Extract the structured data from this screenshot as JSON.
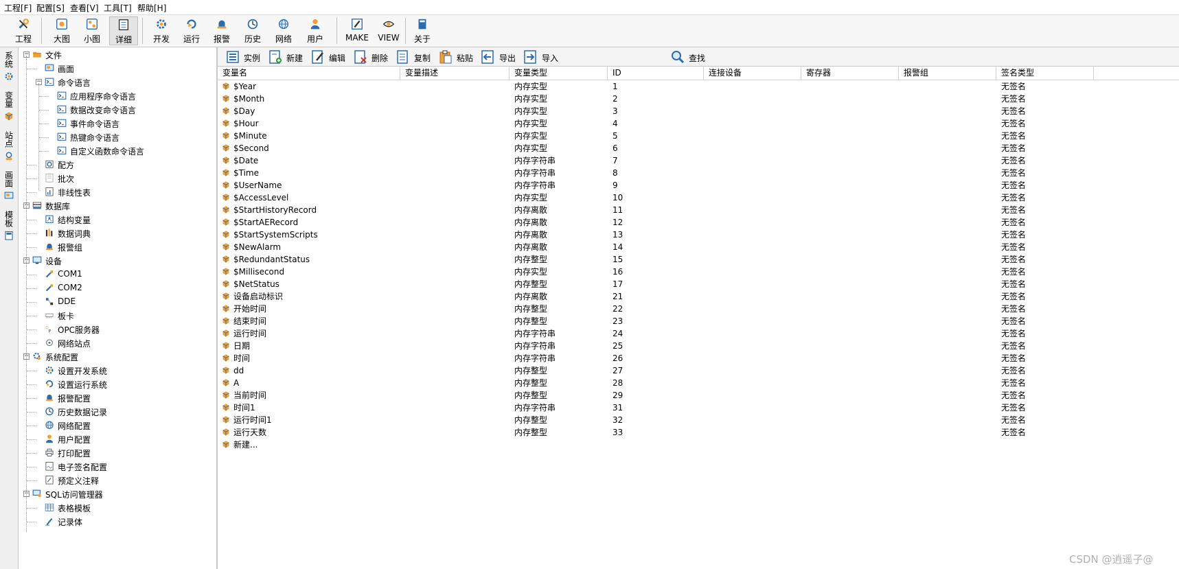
{
  "menu": [
    {
      "name": "menu-project",
      "label": "工程[F]"
    },
    {
      "name": "menu-config",
      "label": "配置[S]"
    },
    {
      "name": "menu-view",
      "label": "查看[V]"
    },
    {
      "name": "menu-tools",
      "label": "工具[T]"
    },
    {
      "name": "menu-help",
      "label": "帮助[H]"
    }
  ],
  "toolbar": [
    {
      "name": "toolbar-project-button",
      "label": "工程",
      "icon": "wrench-icon"
    },
    {
      "name": "toolbar-large-icon-button",
      "label": "大图",
      "icon": "large-icons-icon"
    },
    {
      "name": "toolbar-small-icon-button",
      "label": "小图",
      "icon": "small-icons-icon"
    },
    {
      "name": "toolbar-detail-button",
      "label": "详细",
      "icon": "detail-view-icon",
      "active": true
    },
    {
      "name": "toolbar-develop-button",
      "label": "开发",
      "icon": "develop-gear-icon"
    },
    {
      "name": "toolbar-run-button",
      "label": "运行",
      "icon": "run-icon"
    },
    {
      "name": "toolbar-alarm-button",
      "label": "报警",
      "icon": "alarm-bell-icon"
    },
    {
      "name": "toolbar-history-button",
      "label": "历史",
      "icon": "history-clock-icon"
    },
    {
      "name": "toolbar-network-button",
      "label": "网络",
      "icon": "network-globe-icon"
    },
    {
      "name": "toolbar-user-button",
      "label": "用户",
      "icon": "user-icon"
    },
    {
      "name": "toolbar-make-button",
      "label": "MAKE",
      "icon": "make-pencil-icon"
    },
    {
      "name": "toolbar-view-button",
      "label": "VIEW",
      "icon": "view-eye-icon"
    },
    {
      "name": "toolbar-about-button",
      "label": "关于",
      "icon": "about-book-icon"
    }
  ],
  "vtabs": [
    {
      "name": "vtab-system",
      "label": "系统",
      "icon": "system-gear-icon"
    },
    {
      "name": "vtab-variable",
      "label": "变量",
      "icon": "variable-cube-icon"
    },
    {
      "name": "vtab-station",
      "label": "站点",
      "icon": "station-icon"
    },
    {
      "name": "vtab-screen",
      "label": "画面",
      "icon": "screen-icon"
    },
    {
      "name": "vtab-template",
      "label": "模板",
      "icon": "template-icon"
    }
  ],
  "tree": [
    {
      "level": 0,
      "label": "文件",
      "icon": "folder-icon",
      "expander": "−"
    },
    {
      "level": 1,
      "label": "画面",
      "icon": "screen-icon"
    },
    {
      "level": 1,
      "label": "命令语言",
      "icon": "command-icon",
      "expander": "−"
    },
    {
      "level": 2,
      "label": "应用程序命令语言",
      "icon": "command-icon"
    },
    {
      "level": 2,
      "label": "数据改变命令语言",
      "icon": "command-icon"
    },
    {
      "level": 2,
      "label": "事件命令语言",
      "icon": "command-icon"
    },
    {
      "level": 2,
      "label": "热键命令语言",
      "icon": "command-icon"
    },
    {
      "level": 2,
      "label": "自定义函数命令语言",
      "icon": "command-icon"
    },
    {
      "level": 1,
      "label": "配方",
      "icon": "recipe-icon"
    },
    {
      "level": 1,
      "label": "批次",
      "icon": "batch-icon"
    },
    {
      "level": 1,
      "label": "非线性表",
      "icon": "nonlinear-table-icon"
    },
    {
      "level": 0,
      "label": "数据库",
      "icon": "database-icon",
      "expander": "−"
    },
    {
      "level": 1,
      "label": "结构变量",
      "icon": "struct-variable-icon"
    },
    {
      "level": 1,
      "label": "数据词典",
      "icon": "data-dictionary-icon"
    },
    {
      "level": 1,
      "label": "报警组",
      "icon": "alarm-bell-icon"
    },
    {
      "level": 0,
      "label": "设备",
      "icon": "device-monitor-icon",
      "expander": "−"
    },
    {
      "level": 1,
      "label": "COM1",
      "icon": "com-port-icon"
    },
    {
      "level": 1,
      "label": "COM2",
      "icon": "com-port-icon"
    },
    {
      "level": 1,
      "label": "DDE",
      "icon": "dde-icon"
    },
    {
      "level": 1,
      "label": "板卡",
      "icon": "board-card-icon"
    },
    {
      "level": 1,
      "label": "OPC服务器",
      "icon": "opc-server-icon"
    },
    {
      "level": 1,
      "label": "网络站点",
      "icon": "network-station-icon"
    },
    {
      "level": 0,
      "label": "系统配置",
      "icon": "system-config-icon",
      "expander": "−"
    },
    {
      "level": 1,
      "label": "设置开发系统",
      "icon": "develop-gear-icon"
    },
    {
      "level": 1,
      "label": "设置运行系统",
      "icon": "run-icon"
    },
    {
      "level": 1,
      "label": "报警配置",
      "icon": "alarm-bell-icon"
    },
    {
      "level": 1,
      "label": "历史数据记录",
      "icon": "history-clock-icon"
    },
    {
      "level": 1,
      "label": "网络配置",
      "icon": "network-globe-icon"
    },
    {
      "level": 1,
      "label": "用户配置",
      "icon": "user-icon"
    },
    {
      "level": 1,
      "label": "打印配置",
      "icon": "printer-icon"
    },
    {
      "level": 1,
      "label": "电子签名配置",
      "icon": "e-signature-icon"
    },
    {
      "level": 1,
      "label": "预定义注释",
      "icon": "note-icon"
    },
    {
      "level": 0,
      "label": "SQL访问管理器",
      "icon": "sql-manager-icon",
      "expander": "−"
    },
    {
      "level": 1,
      "label": "表格模板",
      "icon": "table-template-icon"
    },
    {
      "level": 1,
      "label": "记录体",
      "icon": "record-pen-icon"
    }
  ],
  "subtoolbar": [
    {
      "name": "instance-button",
      "label": "实例",
      "icon": "instance-icon"
    },
    {
      "name": "new-button",
      "label": "新建",
      "icon": "new-doc-icon"
    },
    {
      "name": "edit-button",
      "label": "编辑",
      "icon": "edit-doc-icon"
    },
    {
      "name": "delete-button",
      "label": "删除",
      "icon": "delete-doc-icon"
    },
    {
      "name": "copy-button",
      "label": "复制",
      "icon": "copy-doc-icon"
    },
    {
      "name": "paste-button",
      "label": "粘贴",
      "icon": "paste-clipboard-icon"
    },
    {
      "name": "export-button",
      "label": "导出",
      "icon": "export-arrow-icon"
    },
    {
      "name": "import-button",
      "label": "导入",
      "icon": "import-arrow-icon"
    }
  ],
  "search": {
    "placeholder": "",
    "button_label": "查找",
    "icon": "magnifier-icon"
  },
  "table": {
    "columns": [
      "变量名",
      "变量描述",
      "变量类型",
      "ID",
      "连接设备",
      "寄存器",
      "报警组",
      "签名类型"
    ],
    "rows": [
      {
        "name": "$Year",
        "type": "内存实型",
        "id": "1",
        "sign": "无签名"
      },
      {
        "name": "$Month",
        "type": "内存实型",
        "id": "2",
        "sign": "无签名"
      },
      {
        "name": "$Day",
        "type": "内存实型",
        "id": "3",
        "sign": "无签名"
      },
      {
        "name": "$Hour",
        "type": "内存实型",
        "id": "4",
        "sign": "无签名"
      },
      {
        "name": "$Minute",
        "type": "内存实型",
        "id": "5",
        "sign": "无签名"
      },
      {
        "name": "$Second",
        "type": "内存实型",
        "id": "6",
        "sign": "无签名"
      },
      {
        "name": "$Date",
        "type": "内存字符串",
        "id": "7",
        "sign": "无签名"
      },
      {
        "name": "$Time",
        "type": "内存字符串",
        "id": "8",
        "sign": "无签名"
      },
      {
        "name": "$UserName",
        "type": "内存字符串",
        "id": "9",
        "sign": "无签名"
      },
      {
        "name": "$AccessLevel",
        "type": "内存实型",
        "id": "10",
        "sign": "无签名"
      },
      {
        "name": "$StartHistoryRecord",
        "type": "内存离散",
        "id": "11",
        "sign": "无签名"
      },
      {
        "name": "$StartAERecord",
        "type": "内存离散",
        "id": "12",
        "sign": "无签名"
      },
      {
        "name": "$StartSystemScripts",
        "type": "内存离散",
        "id": "13",
        "sign": "无签名"
      },
      {
        "name": "$NewAlarm",
        "type": "内存离散",
        "id": "14",
        "sign": "无签名"
      },
      {
        "name": "$RedundantStatus",
        "type": "内存整型",
        "id": "15",
        "sign": "无签名"
      },
      {
        "name": "$Millisecond",
        "type": "内存实型",
        "id": "16",
        "sign": "无签名"
      },
      {
        "name": "$NetStatus",
        "type": "内存整型",
        "id": "17",
        "sign": "无签名"
      },
      {
        "name": "设备启动标识",
        "type": "内存离散",
        "id": "21",
        "sign": "无签名"
      },
      {
        "name": "开始时间",
        "type": "内存整型",
        "id": "22",
        "sign": "无签名"
      },
      {
        "name": "结束时间",
        "type": "内存整型",
        "id": "23",
        "sign": "无签名"
      },
      {
        "name": "运行时间",
        "type": "内存字符串",
        "id": "24",
        "sign": "无签名"
      },
      {
        "name": "日期",
        "type": "内存字符串",
        "id": "25",
        "sign": "无签名"
      },
      {
        "name": "时间",
        "type": "内存字符串",
        "id": "26",
        "sign": "无签名"
      },
      {
        "name": "dd",
        "type": "内存整型",
        "id": "27",
        "sign": "无签名"
      },
      {
        "name": "A",
        "type": "内存整型",
        "id": "28",
        "sign": "无签名"
      },
      {
        "name": "当前时间",
        "type": "内存整型",
        "id": "29",
        "sign": "无签名"
      },
      {
        "name": "时间1",
        "type": "内存字符串",
        "id": "31",
        "sign": "无签名"
      },
      {
        "name": "运行时间1",
        "type": "内存整型",
        "id": "32",
        "sign": "无签名"
      },
      {
        "name": "运行天数",
        "type": "内存整型",
        "id": "33",
        "sign": "无签名"
      }
    ],
    "new_row_label": "新建..."
  },
  "watermark": "CSDN @逍遥子@",
  "colors": {
    "accent_blue": "#1a5fb4",
    "icon_orange": "#f0a030",
    "cube_blue": "#2b6cb0",
    "toolbar_bg": "#f7f7f7"
  }
}
